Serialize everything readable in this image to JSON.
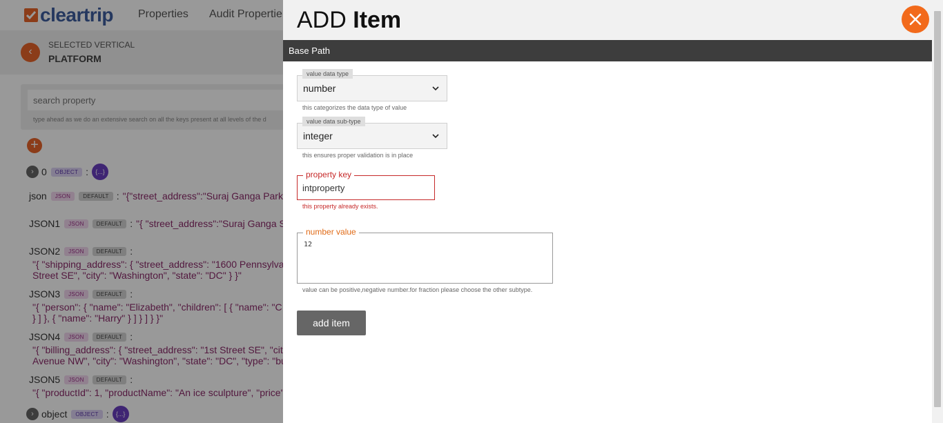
{
  "app": {
    "logo_text": "cleartrip",
    "nav": [
      "Properties",
      "Audit Propertie"
    ],
    "vertical_label": "SELECTED VERTICAL",
    "vertical_value": "PLATFORM",
    "back_icon": "‹",
    "search_placeholder": "search property",
    "search_hint": "type ahead as we do an extensive search on all the keys present at all levels of the d",
    "add_icon": "+",
    "tree": [
      {
        "key": "0",
        "type": "OBJECT",
        "value": "{...}"
      },
      {
        "key": "json",
        "type": "JSON",
        "default": "DEFAULT",
        "value": "\"{\"street_address\":\"Suraj Ganga Park"
      },
      {
        "key": "JSON1",
        "type": "JSON",
        "default": "DEFAULT",
        "value": "\"{ \"street_address\":\"Suraj Ganga S"
      },
      {
        "key": "JSON2",
        "type": "JSON",
        "default": "DEFAULT",
        "lines": [
          "\"{ \"shipping_address\": { \"street_address\": \"1600 Pennsylva",
          "Street SE\", \"city\": \"Washington\", \"state\": \"DC\" } }\""
        ]
      },
      {
        "key": "JSON3",
        "type": "JSON",
        "default": "DEFAULT",
        "lines": [
          "\"{ \"person\": { \"name\": \"Elizabeth\", \"children\": [ { \"name\": \"C",
          "} ] }, { \"name\": \"Harry\" } ] } ] } }\""
        ]
      },
      {
        "key": "JSON4",
        "type": "JSON",
        "default": "DEFAULT",
        "lines": [
          "\"{ \"billing_address\": { \"street_address\": \"1st Street SE\", \"cit",
          "Avenue NW\", \"city\": \"Washington\", \"state\": \"DC\", \"type\": \"bu"
        ]
      },
      {
        "key": "JSON5",
        "type": "JSON",
        "default": "DEFAULT",
        "lines": [
          "\"{ \"productId\": 1, \"productName\": \"An ice sculpture\", \"price\""
        ]
      },
      {
        "key": "object",
        "type": "OBJECT",
        "value": "{...}"
      }
    ]
  },
  "panel": {
    "title_light": "ADD",
    "title_bold": "Item",
    "close_icon": "close-icon",
    "base_path": "Base Path",
    "value_data_type": {
      "label": "value data type",
      "value": "number",
      "help": "this categorizes the data type of value"
    },
    "value_data_subtype": {
      "label": "value data sub-type",
      "value": "integer",
      "help": "this ensures proper validation is in place"
    },
    "property_key": {
      "label": "property key",
      "value": "intproperty",
      "error": "this property already exists."
    },
    "number_value": {
      "label": "number value",
      "value": "12",
      "help": "value can be positive,negative number.for fraction please choose the other subtype."
    },
    "submit_label": "add item"
  },
  "colors": {
    "accent": "#f26a1b",
    "error": "#c62828",
    "brand": "#3e5e9e",
    "header_dark": "#3d3d3d"
  }
}
